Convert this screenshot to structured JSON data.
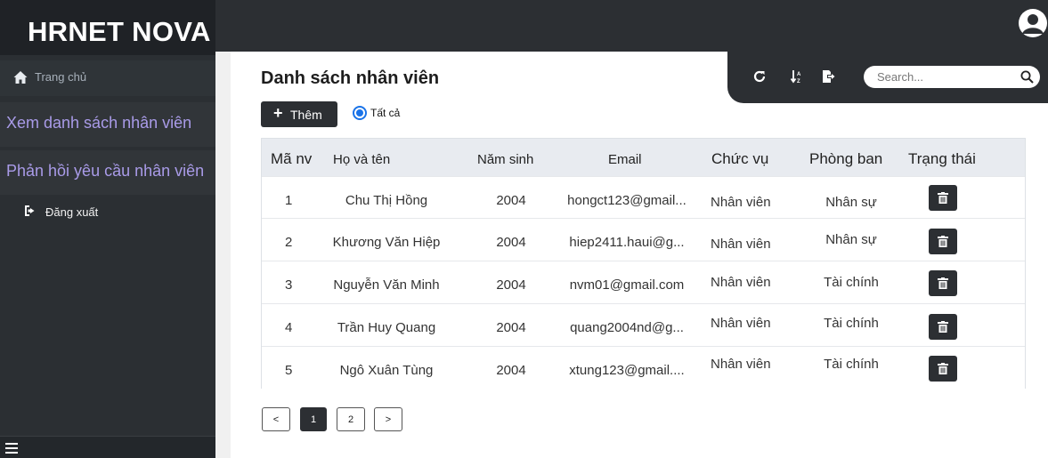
{
  "app": {
    "logo": "HRNET NOVA"
  },
  "sidebar": {
    "home": "Trang chủ",
    "items": [
      "Xem danh sách nhân viên",
      "Phản hồi yêu cầu nhân viên"
    ],
    "logout": "Đăng xuất"
  },
  "page": {
    "title": "Danh sách nhân viên"
  },
  "toolbar": {
    "search_placeholder": "Search..."
  },
  "actions": {
    "add_label": "Thêm",
    "filter_all": "Tất cả"
  },
  "table": {
    "headers": [
      "Mã nv",
      "Họ và tên",
      "Năm sinh",
      "Email",
      "Chức vụ",
      "Phòng ban",
      "Trạng thái"
    ],
    "rows": [
      {
        "id": "1",
        "name": "Chu Thị Hồng",
        "year": "2004",
        "email": "hongct123@gmail...",
        "role": "Nhân viên",
        "dept": "Nhân sự"
      },
      {
        "id": "2",
        "name": "Khương Văn Hiệp",
        "year": "2004",
        "email": "hiep2411.haui@g...",
        "role": "Nhân viên",
        "dept": "Nhân sự"
      },
      {
        "id": "3",
        "name": "Nguyễn Văn Minh",
        "year": "2004",
        "email": "nvm01@gmail.com",
        "role": "Nhân viên",
        "dept": "Tài chính"
      },
      {
        "id": "4",
        "name": "Trần Huy Quang",
        "year": "2004",
        "email": "quang2004nd@g...",
        "role": "Nhân viên",
        "dept": "Tài chính"
      },
      {
        "id": "5",
        "name": "Ngô Xuân Tùng",
        "year": "2004",
        "email": "xtung123@gmail....",
        "role": "Nhân viên",
        "dept": "Tài chính"
      }
    ]
  },
  "pagination": {
    "prev": "<",
    "pages": [
      "1",
      "2"
    ],
    "next": ">",
    "current": "1"
  }
}
